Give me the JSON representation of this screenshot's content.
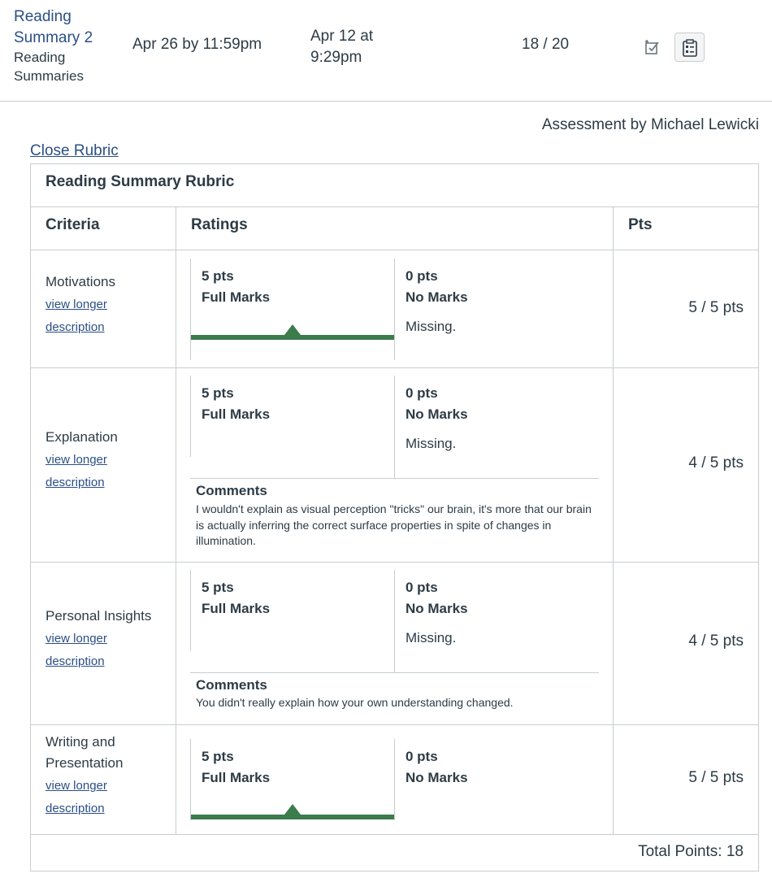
{
  "submission": {
    "assignment_link": "Reading Summary 2",
    "assignment_group": "Reading Summaries",
    "due": "Apr 26 by 11:59pm",
    "submitted": "Apr 12 at 9:29pm",
    "score": "18 / 20",
    "icons": {
      "muted": "muted-checkbox-icon",
      "rubric": "rubric-icon"
    }
  },
  "assessment_by": "Assessment by Michael Lewicki",
  "close_rubric": "Close Rubric",
  "rubric": {
    "title": "Reading Summary Rubric",
    "headers": {
      "criteria": "Criteria",
      "ratings": "Ratings",
      "pts": "Pts"
    },
    "view_longer": "view longer",
    "description": "description",
    "comments_label": "Comments",
    "accent_color": "#3b7b4c",
    "criteria": [
      {
        "name": "Motivations",
        "ratings": [
          {
            "pts": "5 pts",
            "title": "Full Marks",
            "desc": "",
            "selected": true
          },
          {
            "pts": "0 pts",
            "title": "No Marks",
            "desc": "Missing.",
            "selected": false
          }
        ],
        "comment": "",
        "score": "5 / 5 pts"
      },
      {
        "name": "Explanation",
        "ratings": [
          {
            "pts": "5 pts",
            "title": "Full Marks",
            "desc": "",
            "selected": false
          },
          {
            "pts": "0 pts",
            "title": "No Marks",
            "desc": "Missing.",
            "selected": false
          }
        ],
        "comment": "I wouldn't explain as visual perception \"tricks\" our brain, it's more that our brain is actually inferring the correct surface properties in spite of changes in illumination.",
        "score": "4 / 5 pts"
      },
      {
        "name": "Personal Insights",
        "ratings": [
          {
            "pts": "5 pts",
            "title": "Full Marks",
            "desc": "",
            "selected": false
          },
          {
            "pts": "0 pts",
            "title": "No Marks",
            "desc": "Missing.",
            "selected": false
          }
        ],
        "comment": "You didn't really explain how your own understanding changed.",
        "score": "4 / 5 pts"
      },
      {
        "name": "Writing and Presentation",
        "ratings": [
          {
            "pts": "5 pts",
            "title": "Full Marks",
            "desc": "",
            "selected": true
          },
          {
            "pts": "0 pts",
            "title": "No Marks",
            "desc": "",
            "selected": false
          }
        ],
        "comment": "",
        "score": "5 / 5 pts"
      }
    ],
    "total": "Total Points: 18"
  }
}
